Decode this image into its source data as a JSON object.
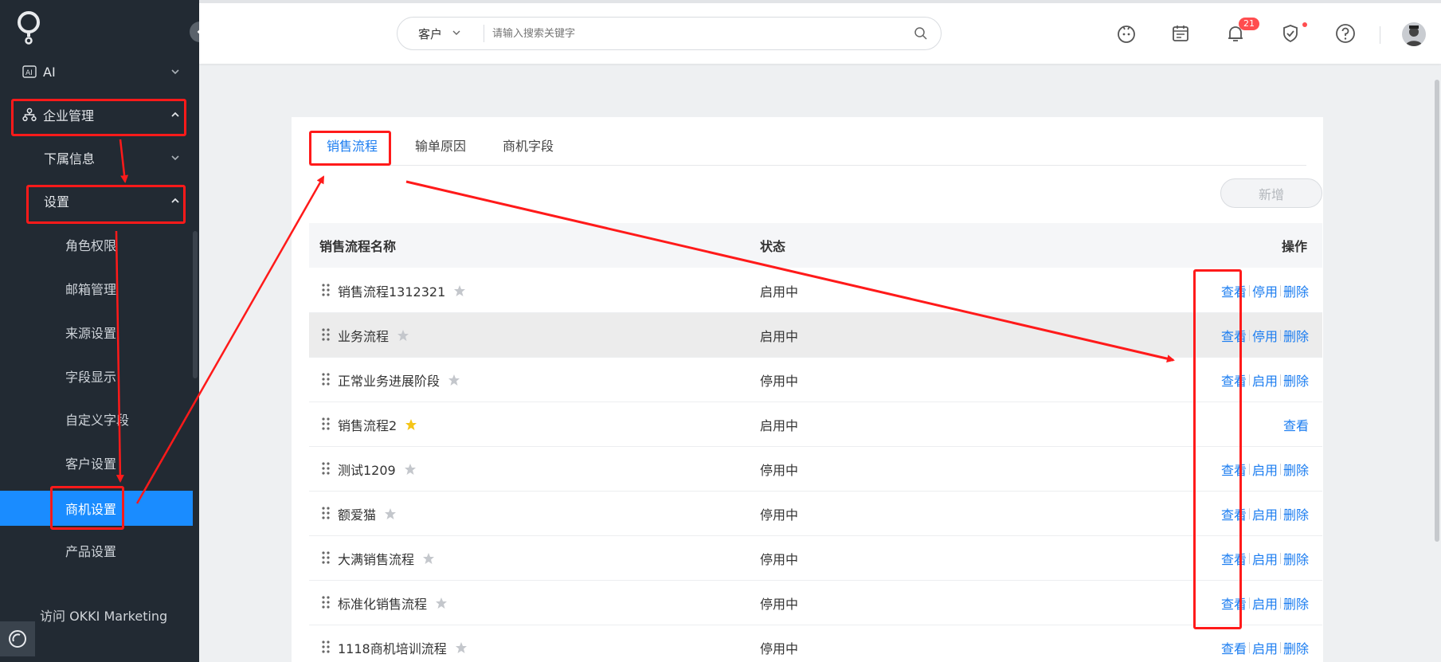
{
  "sidebar": {
    "items": [
      {
        "label": "AI"
      },
      {
        "label": "企业管理"
      },
      {
        "label": "下属信息"
      },
      {
        "label": "设置"
      }
    ],
    "sub_items": [
      "角色权限",
      "邮箱管理",
      "来源设置",
      "字段显示",
      "自定义字段",
      "客户设置",
      "商机设置",
      "产品设置"
    ],
    "active_sub": "商机设置",
    "footer_link": "访问 OKKI Marketing"
  },
  "header": {
    "search_scope": "客户",
    "search_placeholder": "请输入搜索关键字",
    "notification_count": "21",
    "icons": [
      "robot-icon",
      "calendar-icon",
      "bell-icon",
      "shield-check-icon",
      "help-icon"
    ]
  },
  "main": {
    "tabs": [
      "销售流程",
      "输单原因",
      "商机字段"
    ],
    "active_tab": "销售流程",
    "add_button": "新增",
    "table": {
      "headers": [
        "销售流程名称",
        "状态",
        "操作"
      ],
      "rows": [
        {
          "name": "销售流程1312321",
          "starred": false,
          "status": "启用中",
          "ops": [
            "查看",
            "停用",
            "删除"
          ]
        },
        {
          "name": "业务流程",
          "starred": false,
          "status": "启用中",
          "ops": [
            "查看",
            "停用",
            "删除"
          ]
        },
        {
          "name": "正常业务进展阶段",
          "starred": false,
          "status": "停用中",
          "ops": [
            "查看",
            "启用",
            "删除"
          ]
        },
        {
          "name": "销售流程2",
          "starred": true,
          "status": "启用中",
          "ops": [
            "查看"
          ]
        },
        {
          "name": "测试1209",
          "starred": false,
          "status": "停用中",
          "ops": [
            "查看",
            "启用",
            "删除"
          ]
        },
        {
          "name": "额爱猫",
          "starred": false,
          "status": "停用中",
          "ops": [
            "查看",
            "启用",
            "删除"
          ]
        },
        {
          "name": "大满销售流程",
          "starred": false,
          "status": "停用中",
          "ops": [
            "查看",
            "启用",
            "删除"
          ]
        },
        {
          "name": "标准化销售流程",
          "starred": false,
          "status": "停用中",
          "ops": [
            "查看",
            "启用",
            "删除"
          ]
        },
        {
          "name": "1118商机培训流程",
          "starred": false,
          "status": "停用中",
          "ops": [
            "查看",
            "启用",
            "删除"
          ]
        }
      ]
    }
  },
  "colors": {
    "sidebar_bg": "#222a33",
    "accent": "#1a8cff",
    "link": "#1a7cf0",
    "annotation": "#ff1a1a",
    "star_active": "#f5c518",
    "star_inactive": "#c4c7cc"
  }
}
